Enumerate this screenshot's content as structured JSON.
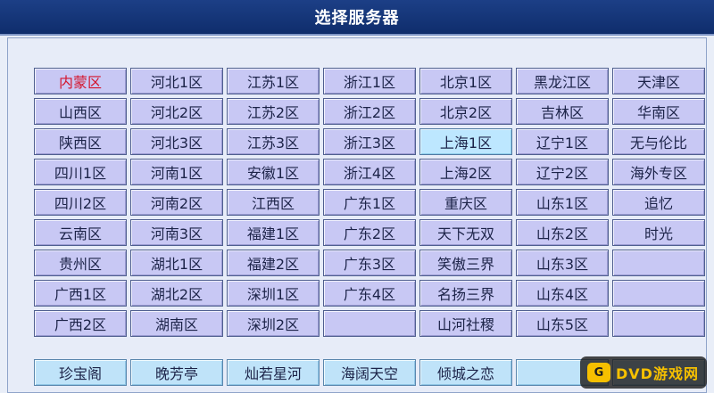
{
  "title": "选择服务器",
  "main_servers": [
    [
      "内蒙区",
      "河北1区",
      "江苏1区",
      "浙江1区",
      "北京1区",
      "黑龙江区",
      "天津区"
    ],
    [
      "山西区",
      "河北2区",
      "江苏2区",
      "浙江2区",
      "北京2区",
      "吉林区",
      "华南区"
    ],
    [
      "陕西区",
      "河北3区",
      "江苏3区",
      "浙江3区",
      "上海1区",
      "辽宁1区",
      "无与伦比"
    ],
    [
      "四川1区",
      "河南1区",
      "安徽1区",
      "浙江4区",
      "上海2区",
      "辽宁2区",
      "海外专区"
    ],
    [
      "四川2区",
      "河南2区",
      "江西区",
      "广东1区",
      "重庆区",
      "山东1区",
      "追忆"
    ],
    [
      "云南区",
      "河南3区",
      "福建1区",
      "广东2区",
      "天下无双",
      "山东2区",
      "时光"
    ],
    [
      "贵州区",
      "湖北1区",
      "福建2区",
      "广东3区",
      "笑傲三界",
      "山东3区",
      ""
    ],
    [
      "广西1区",
      "湖北2区",
      "深圳1区",
      "广东4区",
      "名扬三界",
      "山东4区",
      ""
    ],
    [
      "广西2区",
      "湖南区",
      "深圳2区",
      "",
      "山河社稷",
      "山东5区",
      ""
    ]
  ],
  "bottom_servers": [
    "珍宝阁",
    "晚芳亭",
    "灿若星河",
    "海阔天空",
    "倾城之恋",
    "",
    ""
  ],
  "selected": "内蒙区",
  "highlighted": "上海1区",
  "colors": {
    "title_bg": "#1c3f86",
    "cell_bg": "#c8c8f4",
    "cell_hl": "#bde7ff",
    "selected_text": "#d4142c"
  },
  "watermark": {
    "logo_text": "G",
    "text": "DVD游戏网"
  }
}
